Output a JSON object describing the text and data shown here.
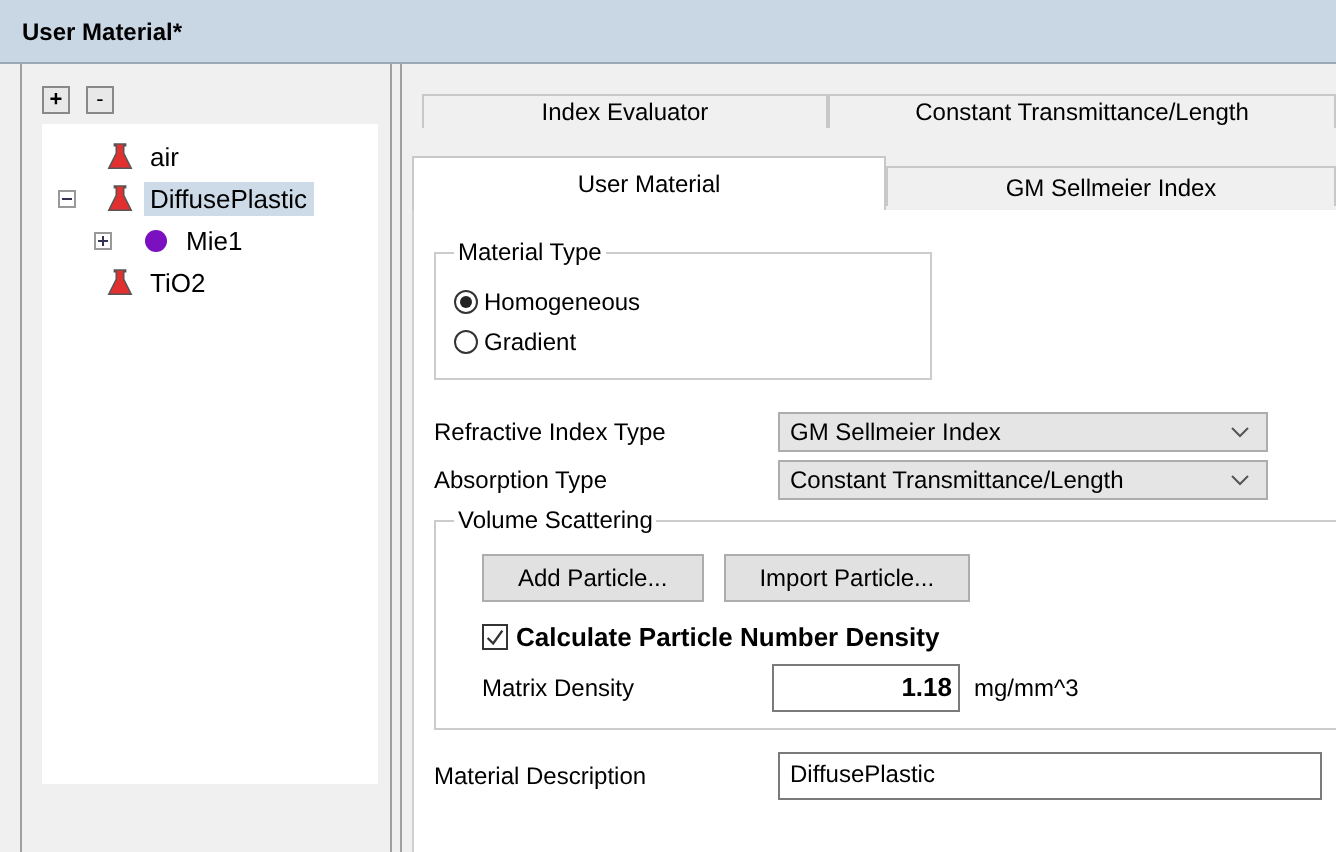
{
  "window": {
    "title": "User Material*"
  },
  "tree_toolbar": {
    "expand_label": "+",
    "collapse_label": "-"
  },
  "tree": [
    {
      "label": "air",
      "kind": "material",
      "selected": false
    },
    {
      "label": "DiffusePlastic",
      "kind": "material",
      "selected": true,
      "expanded": true,
      "children": [
        {
          "label": "Mie1",
          "kind": "particle",
          "selected": false,
          "expanded": false
        }
      ]
    },
    {
      "label": "TiO2",
      "kind": "material",
      "selected": false
    }
  ],
  "tab_rows": [
    [
      {
        "label": "Index Evaluator",
        "selected": false
      },
      {
        "label": "Constant Transmittance/Length",
        "selected": false
      }
    ],
    [
      {
        "label": "User Material",
        "selected": true
      },
      {
        "label": "GM Sellmeier Index",
        "selected": false
      }
    ]
  ],
  "material_type": {
    "label": "Material Type",
    "options": [
      {
        "label": "Homogeneous",
        "selected": true
      },
      {
        "label": "Gradient",
        "selected": false
      }
    ]
  },
  "refractive_index_type": {
    "label": "Refractive Index Type",
    "value": "GM Sellmeier Index"
  },
  "absorption_type": {
    "label": "Absorption Type",
    "value": "Constant Transmittance/Length"
  },
  "volume_scattering": {
    "label": "Volume Scattering",
    "buttons": [
      "Add Particle...",
      "Import Particle..."
    ],
    "calculate_density": {
      "label": "Calculate Particle Number Density",
      "checked": true
    },
    "matrix_density": {
      "label": "Matrix Density",
      "value": "1.18",
      "unit": "mg/mm^3"
    }
  },
  "material_description": {
    "label": "Material Description",
    "value": "DiffusePlastic"
  }
}
